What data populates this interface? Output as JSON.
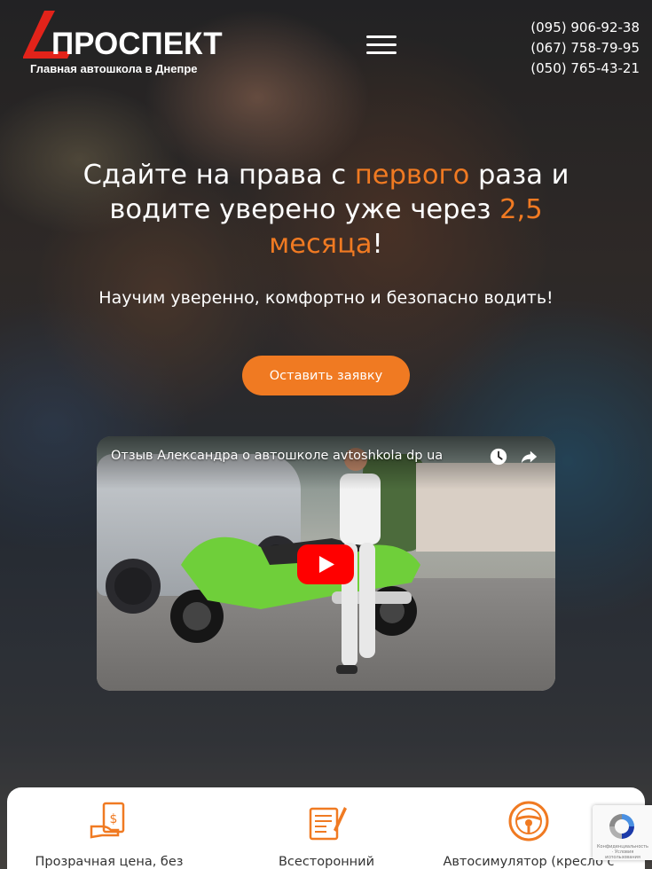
{
  "brand": {
    "name": "ПРОСПЕКТ",
    "tagline": "Главная автошкола в Днепре",
    "logo_color": "#e2231a"
  },
  "header": {
    "menu_icon": "hamburger-menu-icon",
    "phones": [
      "(095) 906-92-38",
      "(067) 758-79-95",
      "(050) 765-43-21"
    ]
  },
  "hero": {
    "headline_part1": "Сдайте на права с ",
    "headline_accent1": "первого",
    "headline_part2": " раза и водите уверено уже через ",
    "headline_accent2": "2,5 месяца",
    "headline_part3": "!",
    "subheadline": "Научим уверенно, комфортно и безопасно водить!",
    "cta_label": "Оставить заявку",
    "accent_color": "#f07a22"
  },
  "video": {
    "title": "Отзыв Александра о автошколе avtoshkola dp ua",
    "icons": [
      "watch-later-icon",
      "share-icon",
      "youtube-play-icon"
    ]
  },
  "features": [
    {
      "icon": "cash-hand-icon",
      "label": "Прозрачная цена, без"
    },
    {
      "icon": "document-pen-icon",
      "label": "Всесторонний"
    },
    {
      "icon": "steering-wheel-icon",
      "label": "Автосимулятор (кресло с"
    }
  ],
  "recaptcha": {
    "text": "Конфиденциальность · Условия использования"
  }
}
